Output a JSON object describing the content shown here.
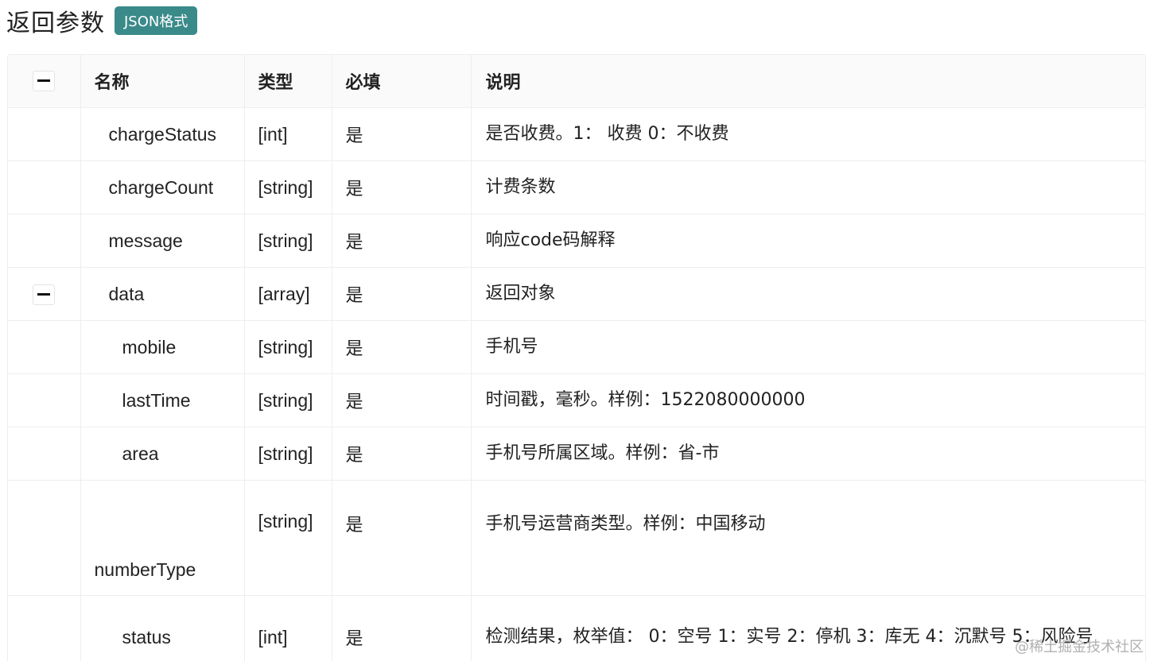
{
  "heading": {
    "title": "返回参数",
    "badge": "JSON格式"
  },
  "table": {
    "headers": {
      "name": "名称",
      "type": "类型",
      "required": "必填",
      "description": "说明"
    },
    "rows": [
      {
        "name": "chargeStatus",
        "type": "[int]",
        "required": "是",
        "description": "是否收费。1： 收费 0：不收费"
      },
      {
        "name": "chargeCount",
        "type": "[string]",
        "required": "是",
        "description": "计费条数"
      },
      {
        "name": "message",
        "type": "[string]",
        "required": "是",
        "description": "响应code码解释"
      },
      {
        "name": "data",
        "type": "[array]",
        "required": "是",
        "description": "返回对象"
      },
      {
        "name": "mobile",
        "type": "[string]",
        "required": "是",
        "description": "手机号"
      },
      {
        "name": "lastTime",
        "type": "[string]",
        "required": "是",
        "description": "时间戳，毫秒。样例：1522080000000"
      },
      {
        "name": "area",
        "type": "[string]",
        "required": "是",
        "description": "手机号所属区域。样例：省-市"
      },
      {
        "name": "numberType",
        "type": "[string]",
        "required": "是",
        "description": "手机号运营商类型。样例：中国移动"
      },
      {
        "name": "status",
        "type": "[int]",
        "required": "是",
        "description": "检测结果，枚举值： 0：空号 1：实号 2：停机 3：库无 4：沉默号 5：风险号"
      }
    ]
  },
  "watermark": "@稀土掘金技术社区"
}
